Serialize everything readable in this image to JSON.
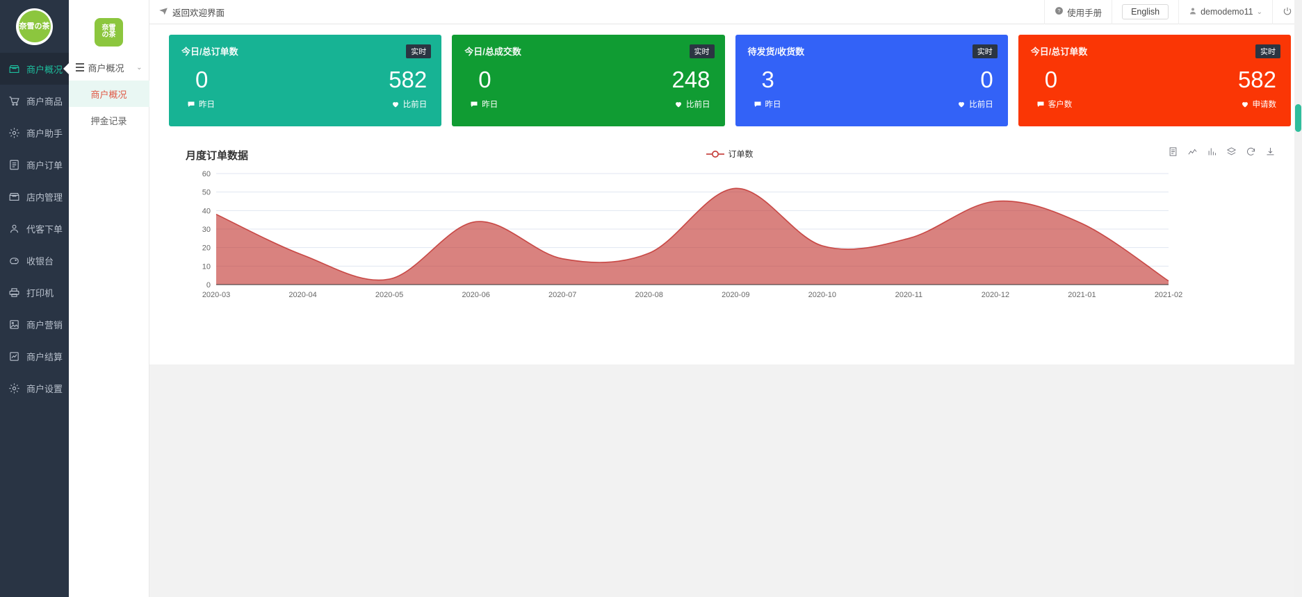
{
  "brand": {
    "logo_line1": "奈雪",
    "logo_line2": "の茶"
  },
  "sidebar": {
    "items": [
      {
        "label": "商户概况",
        "icon": "shop-icon",
        "active": true
      },
      {
        "label": "商户商品",
        "icon": "cart-icon",
        "active": false
      },
      {
        "label": "商户助手",
        "icon": "gear-icon",
        "active": false
      },
      {
        "label": "商户订单",
        "icon": "document-icon",
        "active": false
      },
      {
        "label": "店内管理",
        "icon": "shop-icon",
        "active": false
      },
      {
        "label": "代客下单",
        "icon": "user-icon",
        "active": false
      },
      {
        "label": "收银台",
        "icon": "piggy-bank-icon",
        "active": false
      },
      {
        "label": "打印机",
        "icon": "printer-icon",
        "active": false
      },
      {
        "label": "商户营销",
        "icon": "image-icon",
        "active": false
      },
      {
        "label": "商户结算",
        "icon": "chart-box-icon",
        "active": false
      },
      {
        "label": "商户设置",
        "icon": "gear-icon",
        "active": false
      }
    ]
  },
  "subsidebar": {
    "group_label": "商户概况",
    "items": [
      {
        "label": "商户概况",
        "active": true
      },
      {
        "label": "押金记录",
        "active": false
      }
    ]
  },
  "topbar": {
    "back_label": "返回欢迎界面",
    "manual_label": "使用手册",
    "language_label": "English",
    "user_label": "demodemo11",
    "logout_label": ""
  },
  "cards": [
    {
      "title": "今日/总订单数",
      "badge": "实时",
      "value_left": "0",
      "value_right": "582",
      "foot_left": "昨日",
      "foot_right": "比前日",
      "foot_left_icon": "comment-icon",
      "foot_right_icon": "heart-icon",
      "color": "#17b394"
    },
    {
      "title": "今日/总成交数",
      "badge": "实时",
      "value_left": "0",
      "value_right": "248",
      "foot_left": "昨日",
      "foot_right": "比前日",
      "foot_left_icon": "comment-icon",
      "foot_right_icon": "heart-icon",
      "color": "#109c33"
    },
    {
      "title": "待发货/收货数",
      "badge": "实时",
      "value_left": "3",
      "value_right": "0",
      "foot_left": "昨日",
      "foot_right": "比前日",
      "foot_left_icon": "comment-icon",
      "foot_right_icon": "heart-icon",
      "color": "#3362f7"
    },
    {
      "title": "今日/总订单数",
      "badge": "实时",
      "value_left": "0",
      "value_right": "582",
      "foot_left": "客户数",
      "foot_right": "申请数",
      "foot_left_icon": "comment-icon",
      "foot_right_icon": "heart-icon",
      "color": "#fa3605"
    }
  ],
  "panel": {
    "title": "月度订单数据",
    "toolbar_icons": [
      "data-view-icon",
      "line-chart-icon",
      "bar-chart-icon",
      "stack-icon",
      "refresh-icon",
      "download-icon"
    ]
  },
  "chart_data": {
    "type": "area",
    "title": "月度订单数据",
    "legend": [
      "订单数"
    ],
    "legend_position": "top-center",
    "series_color": "#c23531",
    "xlabel": "",
    "ylabel": "",
    "ylim": [
      0,
      60
    ],
    "yticks": [
      0,
      10,
      20,
      30,
      40,
      50,
      60
    ],
    "grid": true,
    "categories": [
      "2020-03",
      "2020-04",
      "2020-05",
      "2020-06",
      "2020-07",
      "2020-08",
      "2020-09",
      "2020-10",
      "2020-11",
      "2020-12",
      "2021-01",
      "2021-02"
    ],
    "series": [
      {
        "name": "订单数",
        "values": [
          38,
          16,
          3,
          34,
          14,
          17,
          52,
          21,
          25,
          45,
          33,
          2
        ]
      }
    ]
  }
}
